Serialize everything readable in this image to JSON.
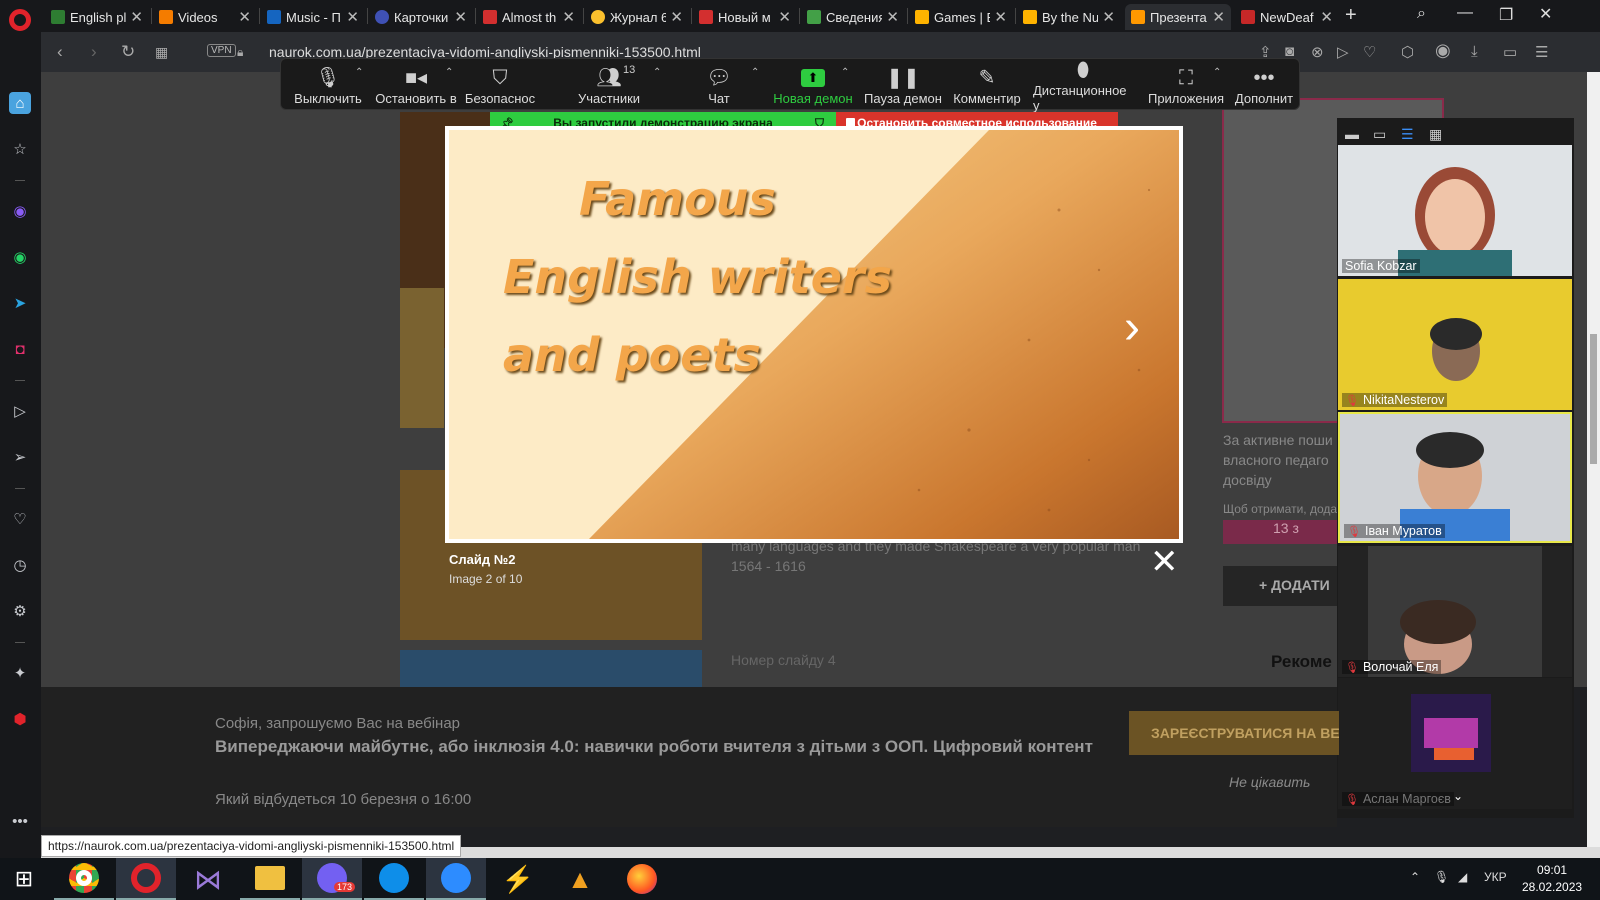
{
  "browser": {
    "tabs": [
      {
        "title": "English pl",
        "color": "#2e7d32"
      },
      {
        "title": "Videos",
        "color": "#f57c00"
      },
      {
        "title": "Music - П",
        "color": "#1565c0"
      },
      {
        "title": "Карточки",
        "color": "#3f51b5"
      },
      {
        "title": "Almost th",
        "color": "#d32f2f"
      },
      {
        "title": "Журнал 6",
        "color": "#fbc02d"
      },
      {
        "title": "Новый м",
        "color": "#d32f2f"
      },
      {
        "title": "Сведения",
        "color": "#43a047"
      },
      {
        "title": "Games | E",
        "color": "#ffb300"
      },
      {
        "title": "By the Nu",
        "color": "#ffb300"
      },
      {
        "title": "Презента",
        "color": "#ff9800"
      },
      {
        "title": "NewDeaf",
        "color": "#c62828"
      }
    ],
    "url": "naurok.com.ua/prezentaciya-vidomi-angliyski-pismenniki-153500.html",
    "vpn_label": "VPN",
    "status_url": "https://naurok.com.ua/prezentaciya-vidomi-angliyski-pismenniki-153500.html"
  },
  "zoom_toolbar": {
    "buttons": [
      {
        "label": "Выключить",
        "icon": "microphone-icon"
      },
      {
        "label": "Остановить в",
        "icon": "video-camera-icon"
      },
      {
        "label": "Безопаснос",
        "icon": "shield-icon"
      },
      {
        "label": "Участники",
        "icon": "participants-icon"
      },
      {
        "label": "Чат",
        "icon": "chat-bubble-icon"
      },
      {
        "label": "Новая демон",
        "icon": "share-screen-icon"
      },
      {
        "label": "Пауза демон",
        "icon": "pause-icon"
      },
      {
        "label": "Комментир",
        "icon": "pencil-icon"
      },
      {
        "label": "Дистанционное у",
        "icon": "mouse-icon"
      },
      {
        "label": "Приложения",
        "icon": "apps-icon"
      },
      {
        "label": "Дополнит",
        "icon": "more-dots-icon"
      }
    ],
    "participants_count": "13",
    "sharing_notice": "Вы запустили демонстрацию экрана",
    "stop_sharing": "Остановить совместное использование"
  },
  "slide": {
    "line1": "Famous",
    "line2": "English writers",
    "line3": "and poets",
    "caption_title": "Слайд №2",
    "caption_sub": "Image 2 of 10"
  },
  "page_behind": {
    "text1": "many languages and they made Shakespeare a very popular man",
    "text2": "1564 - 1616",
    "text3": "Номер слайду 4",
    "side_text": "За активне поши власного педаго досвіду",
    "side_small": "Щоб отримати, дода",
    "side_badge": "13 з",
    "add_button": "+ ДОДАТИ",
    "recommend": "Рекоме"
  },
  "participants": [
    {
      "name": "Sofia Kobzar",
      "muted": false
    },
    {
      "name": "NikitaNesterov",
      "muted": true
    },
    {
      "name": "Іван Муратов",
      "muted": true
    },
    {
      "name": "Волочай Еля",
      "muted": true
    },
    {
      "name": "Аслан Маргоєв",
      "muted": true
    }
  ],
  "banner": {
    "invite": "Софія, запрошуємо Вас на вебінар",
    "title": "Випереджаючи майбутнє, або інклюзія 4.0: навички роботи вчителя з дітьми з ООП. Цифровий контент",
    "date": "Який відбудеться 10 березня о 16:00",
    "register": "ЗАРЕЄСТРУВАТИСЯ НА ВЕ",
    "decline": "Не цікавить"
  },
  "taskbar": {
    "viber_badge": "173",
    "lang": "УКР",
    "time": "09:01",
    "date": "28.02.2023"
  },
  "colors": {
    "zoom_green": "#2ecc40",
    "zoom_red": "#d9342b",
    "slide_text": "#f3a64a"
  }
}
